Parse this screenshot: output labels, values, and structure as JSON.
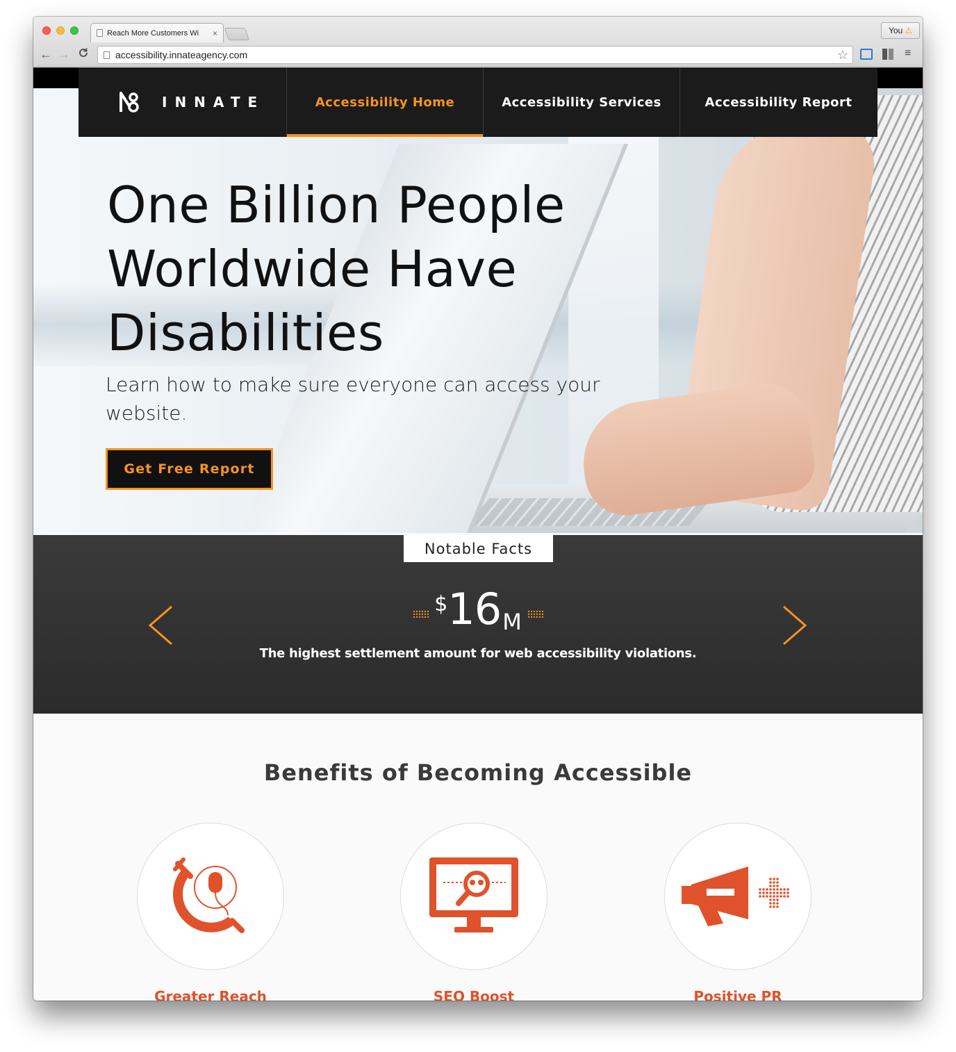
{
  "browser": {
    "tab_title": "Reach More Customers Wi",
    "tab_close": "×",
    "profile_label": "You",
    "url": "accessibility.innateagency.com",
    "back": "←",
    "forward": "→",
    "reload": "C",
    "star": "☆",
    "menu": "≡",
    "warning": "⚠"
  },
  "site": {
    "brand_name": "INNATE",
    "nav": [
      {
        "label": "Accessibility Home",
        "active": true
      },
      {
        "label": "Accessibility Services",
        "active": false
      },
      {
        "label": "Accessibility Report",
        "active": false
      }
    ]
  },
  "hero": {
    "title_line1": "One Billion People",
    "title_line2": "Worldwide Have",
    "title_line3": "Disabilities",
    "subtitle": "Learn how to make sure everyone can access your website.",
    "cta": "Get Free Report"
  },
  "facts": {
    "tab_label": "Notable Facts",
    "value_prefix": "$",
    "value_number": "16",
    "value_unit": "M",
    "caption": "The highest settlement amount for web accessibility violations."
  },
  "benefits": {
    "title": "Benefits of Becoming Accessible",
    "items": [
      {
        "label": "Greater Reach",
        "icon": "globe-mouse-icon"
      },
      {
        "label": "SEO Boost",
        "icon": "monitor-search-icon"
      },
      {
        "label": "Positive PR",
        "icon": "megaphone-icon"
      }
    ]
  },
  "colors": {
    "accent_orange": "#f7941d",
    "benefit_orange": "#e0522b",
    "nav_bg": "#1b1b1b",
    "facts_bg": "#333333"
  }
}
